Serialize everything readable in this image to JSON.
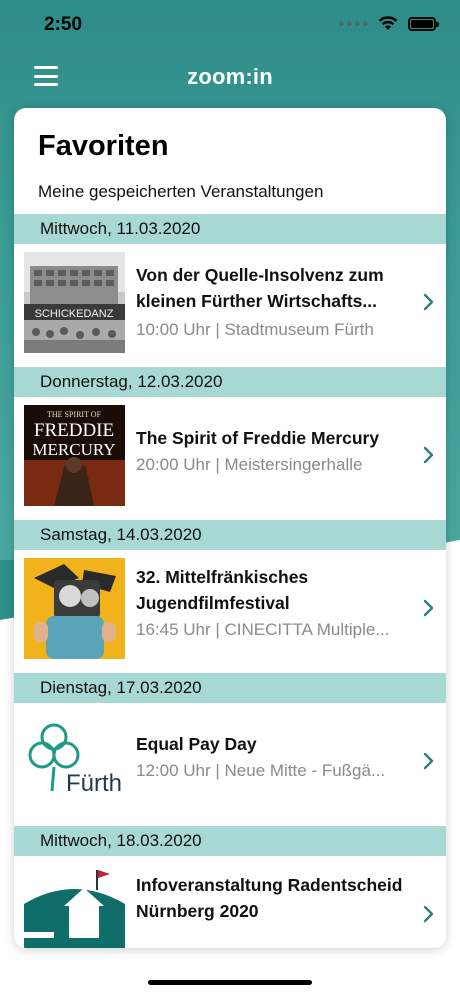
{
  "status": {
    "time": "2:50"
  },
  "app": {
    "title": "zoom:in"
  },
  "page": {
    "title": "Favoriten",
    "subtitle": "Meine gespeicherten Veranstaltungen"
  },
  "sections": [
    {
      "date": "Mittwoch, 11.03.2020",
      "event": {
        "title": "Von der Quelle-Insolvenz zum kleinen Fürther Wirtschafts...",
        "meta": "10:00 Uhr | Stadtmuseum Fürth",
        "image_text": "SCHICKEDANZ"
      }
    },
    {
      "date": "Donnerstag, 12.03.2020",
      "event": {
        "title": "The Spirit of Freddie Mercury",
        "meta": "20:00 Uhr | Meistersingerhalle",
        "image_text": [
          "THE SPIRIT OF",
          "FREDDIE",
          "MERCURY"
        ]
      }
    },
    {
      "date": "Samstag, 14.03.2020",
      "event": {
        "title": "32. Mittelfränkisches Jugendfilmfestival",
        "meta": "16:45 Uhr | CINECITTA Multiple..."
      }
    },
    {
      "date": "Dienstag, 17.03.2020",
      "event": {
        "title": "Equal Pay Day",
        "meta": "12:00 Uhr | Neue Mitte - Fußgä...",
        "image_text": "Fürth"
      }
    },
    {
      "date": "Mittwoch, 18.03.2020",
      "event": {
        "title": "Infoveranstaltung Radentscheid Nürnberg 2020",
        "meta": ""
      }
    }
  ],
  "colors": {
    "accent": "#2f8f8a",
    "date_header": "#a8d8d3",
    "chevron": "#2f7f7a"
  },
  "icons": [
    "menu-icon",
    "wifi-icon",
    "battery-icon",
    "signal-icon",
    "chevron-right-icon"
  ]
}
